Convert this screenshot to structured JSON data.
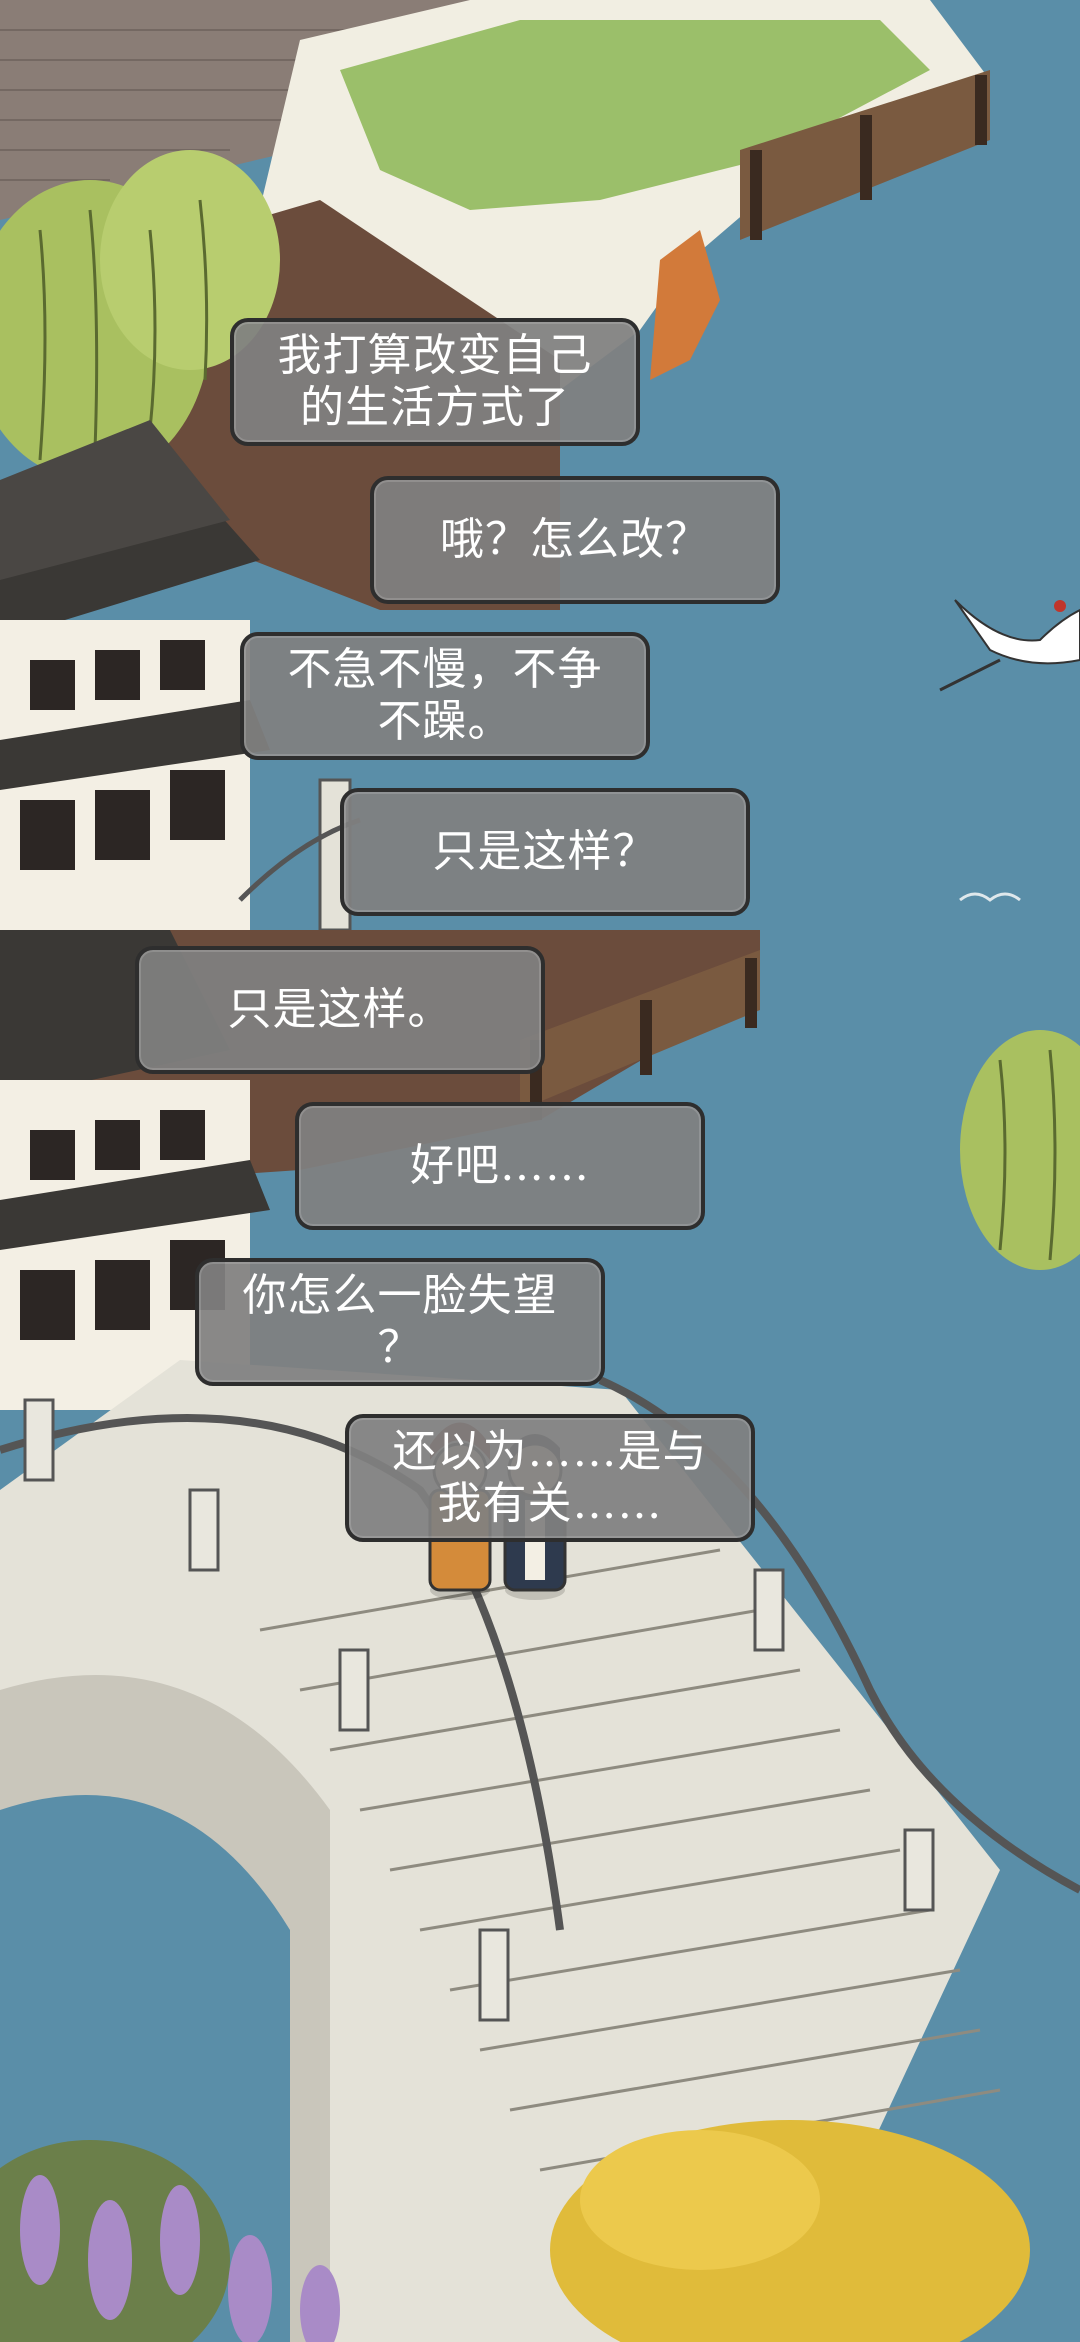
{
  "dialogue": [
    {
      "speaker": "left",
      "text": "我打算改变自己\n的生活方式了"
    },
    {
      "speaker": "right",
      "text": "哦？怎么改？"
    },
    {
      "speaker": "left",
      "text": "不急不慢，不争\n不躁。"
    },
    {
      "speaker": "right",
      "text": "只是这样？"
    },
    {
      "speaker": "left",
      "text": "只是这样。"
    },
    {
      "speaker": "right",
      "text": "好吧……"
    },
    {
      "speaker": "left",
      "text": "你怎么一脸失望\n？"
    },
    {
      "speaker": "right",
      "text": "还以为……是与\n我有关……"
    }
  ],
  "colors": {
    "water": "#5a8ea8",
    "bubble_bg": "#808080",
    "bubble_border": "#2e2e2e",
    "stone": "#e4e2d8",
    "roof": "#3a3835",
    "willow": "#a9c060",
    "grass": "#9bbf6a",
    "wisteria": "#a98bc7",
    "blossom": "#e0bb3a"
  }
}
